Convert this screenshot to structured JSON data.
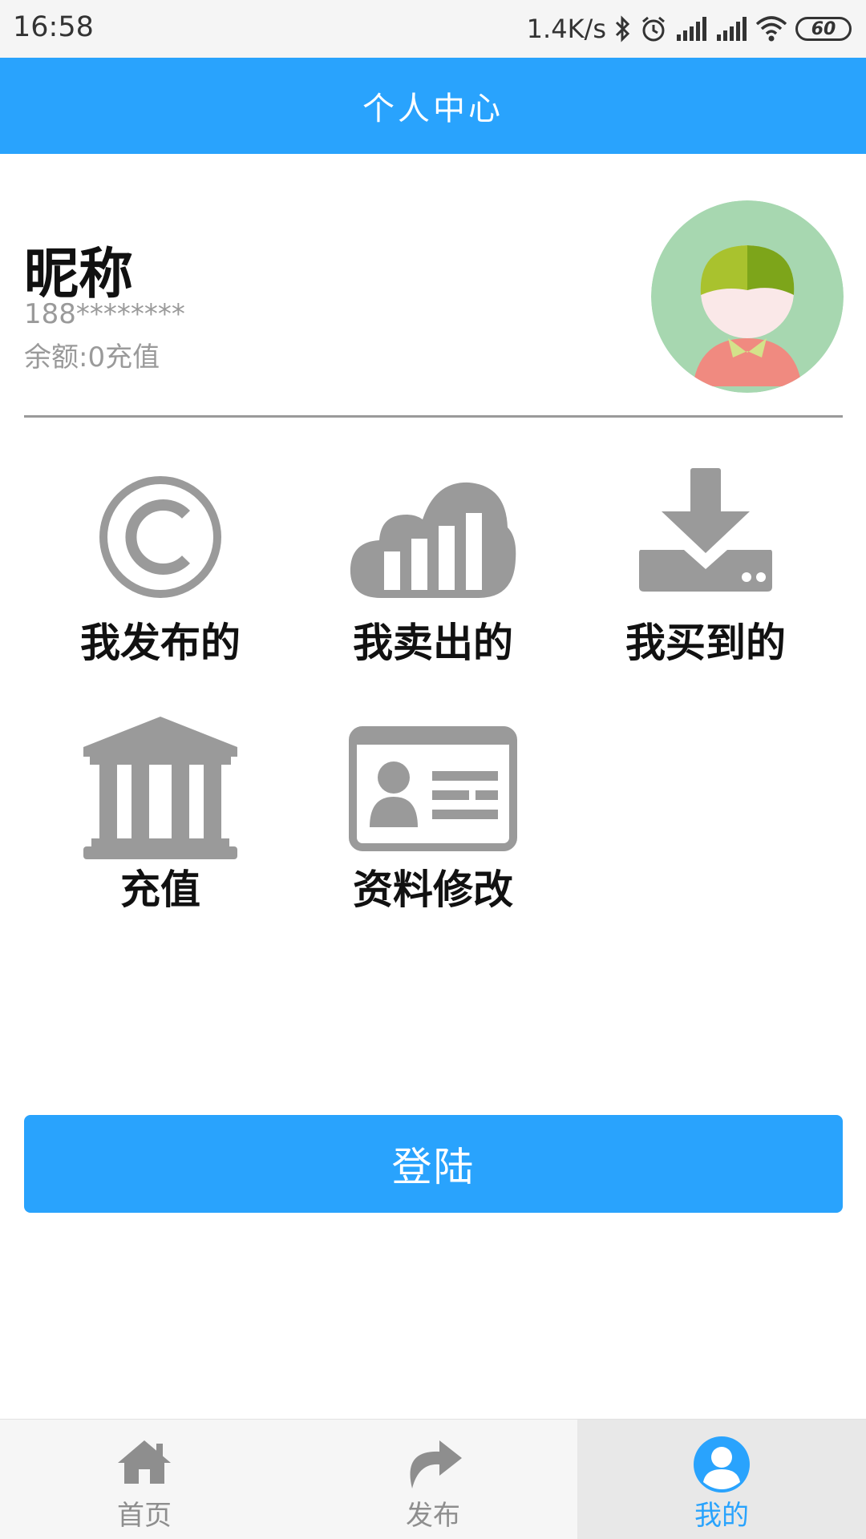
{
  "status_bar": {
    "time": "16:58",
    "speed": "1.4K/s",
    "battery": "60",
    "icons": [
      "bluetooth-icon",
      "alarm-icon",
      "signal-icon",
      "signal-icon",
      "wifi-icon",
      "battery-icon"
    ]
  },
  "header": {
    "title": "个人中心"
  },
  "profile": {
    "nickname": "昵称",
    "phone": "188********",
    "balance": "余额:0充值",
    "avatar_icon": "avatar-icon"
  },
  "menu": {
    "items": [
      {
        "label": "我发布的",
        "icon": "copyright-icon"
      },
      {
        "label": "我卖出的",
        "icon": "cloud-chart-icon"
      },
      {
        "label": "我买到的",
        "icon": "download-tray-icon"
      },
      {
        "label": "充值",
        "icon": "bank-icon"
      },
      {
        "label": "资料修改",
        "icon": "id-card-icon"
      }
    ]
  },
  "login_button": {
    "label": "登陆"
  },
  "bottom_nav": {
    "items": [
      {
        "label": "首页",
        "icon": "home-icon"
      },
      {
        "label": "发布",
        "icon": "share-arrow-icon"
      },
      {
        "label": "我的",
        "icon": "user-icon",
        "active": true
      }
    ]
  },
  "colors": {
    "accent": "#29a3fd",
    "icon_gray": "#9a9a9a",
    "text_dark": "#111111"
  }
}
